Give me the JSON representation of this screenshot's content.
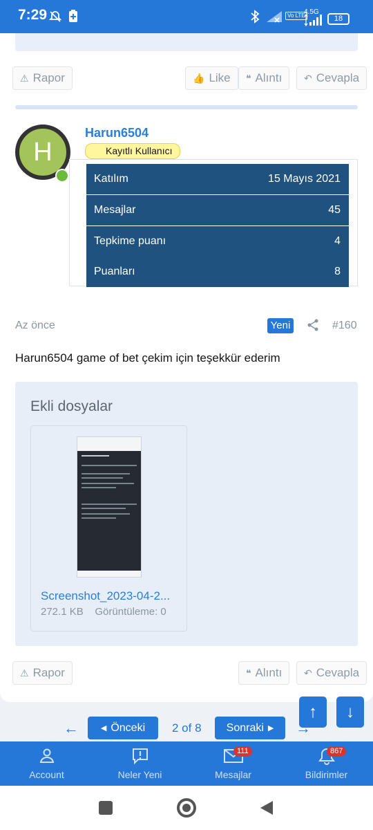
{
  "status_bar": {
    "time": "7:29",
    "network": "4.5G",
    "volte": "Vo LTE",
    "battery": "18"
  },
  "prev_post": {
    "report_label": "Rapor",
    "like_label": "Like",
    "quote_label": "Alıntı",
    "reply_label": "Cevapla"
  },
  "user": {
    "avatar_letter": "H",
    "name": "Harun6504",
    "role": "Kayıtlı Kullanıcı"
  },
  "stats": [
    {
      "label": "Katılım",
      "value": "15 Mayıs 2021"
    },
    {
      "label": "Mesajlar",
      "value": "45"
    },
    {
      "label": "Tepkime puanı",
      "value": "4"
    },
    {
      "label": "Puanları",
      "value": "8"
    }
  ],
  "post": {
    "time": "Az önce",
    "new_badge": "Yeni",
    "number": "#160",
    "message": "Harun6504 game of bet çekim için teşekkür ederim",
    "attachments_title": "Ekli dosyalar",
    "attachment": {
      "name": "Screenshot_2023-04-2...",
      "size": "272.1 KB",
      "views": "Görüntüleme: 0"
    },
    "report_label": "Rapor",
    "quote_label": "Alıntı",
    "reply_label": "Cevapla"
  },
  "pagination": {
    "prev_label": "Önceki",
    "page": "2 of 8",
    "next_label": "Sonraki"
  },
  "bottom_nav": [
    {
      "label": "Account",
      "icon": "person-icon"
    },
    {
      "label": "Neler Yeni",
      "icon": "alert-icon"
    },
    {
      "label": "Mesajlar",
      "icon": "mail-icon",
      "count": "111"
    },
    {
      "label": "Bildirimler",
      "icon": "bell-icon",
      "count": "867"
    }
  ],
  "colors": {
    "primary": "#2577d8",
    "stats_bg": "#1f527f",
    "link": "#2a7fd5",
    "badge_red": "#d8352f"
  }
}
